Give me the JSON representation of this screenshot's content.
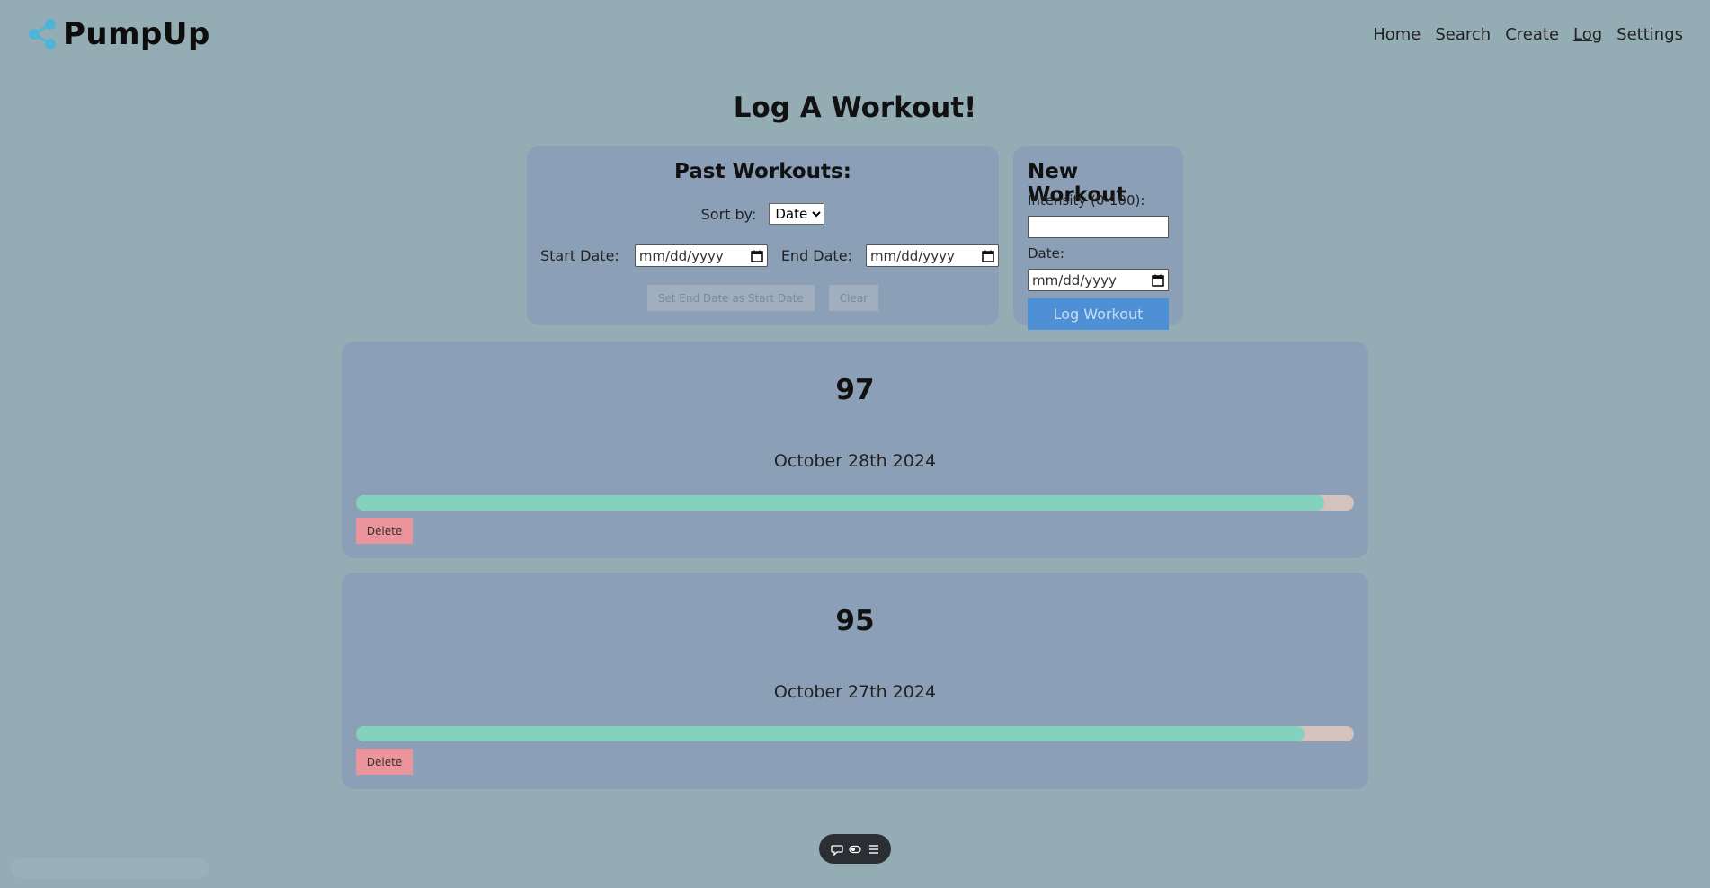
{
  "brand": {
    "name": "PumpUp"
  },
  "nav": {
    "items": [
      {
        "label": "Home"
      },
      {
        "label": "Search"
      },
      {
        "label": "Create"
      },
      {
        "label": "Log"
      },
      {
        "label": "Settings"
      }
    ],
    "active": "Log"
  },
  "page": {
    "title": "Log A Workout!"
  },
  "past": {
    "title": "Past Workouts:",
    "sort_label": "Sort by:",
    "sort_value": "Date",
    "start_label": "Start Date:",
    "end_label": "End Date:",
    "date_placeholder": "mm/dd/yyyy",
    "set_end_button": "Set End Date as Start Date",
    "clear_button": "Clear"
  },
  "new_workout": {
    "title": "New Workout",
    "intensity_label": "Intensity (0-100):",
    "intensity_value": "",
    "date_label": "Date:",
    "date_placeholder": "mm/dd/yyyy",
    "submit_label": "Log Workout"
  },
  "workouts": [
    {
      "intensity": "97",
      "date": "October 28th 2024",
      "progress": 0.97,
      "delete_label": "Delete"
    },
    {
      "intensity": "95",
      "date": "October 27th 2024",
      "progress": 0.95,
      "delete_label": "Delete"
    }
  ],
  "colors": {
    "background": "#94adb5",
    "panel": "#8ba0b7",
    "progress_fill": "#84d1c0",
    "progress_track": "#d4c2be",
    "delete": "#ec949c",
    "primary": "#4d90d6"
  }
}
